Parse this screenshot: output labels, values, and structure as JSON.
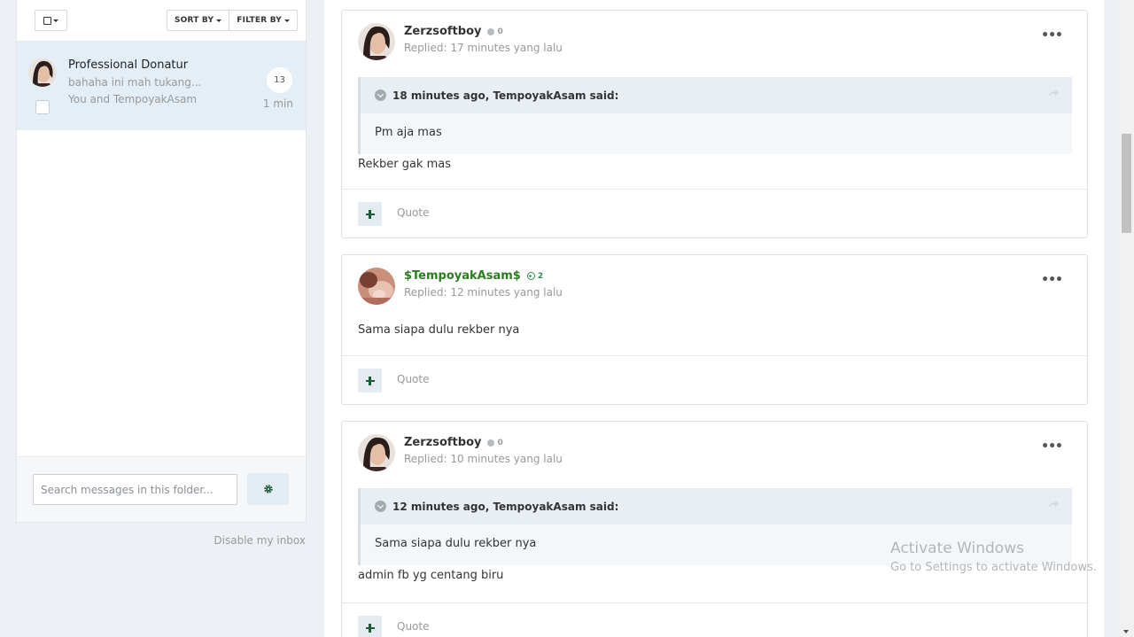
{
  "inbox": {
    "sort_label": "SORT BY",
    "filter_label": "FILTER BY",
    "conversation": {
      "title": "Professional Donatur",
      "snippet": "bahaha ini mah tukang...",
      "participants": "You and TempoyakAsam",
      "count": "13",
      "time": "1 min"
    },
    "search_placeholder": "Search messages in this folder...",
    "disable_link": "Disable my inbox"
  },
  "posts": [
    {
      "author": "Zerzsoftboy",
      "reputation": "0",
      "meta": "Replied: 17 minutes yang lalu",
      "quote_citation": "18 minutes ago, TempoyakAsam said:",
      "quote_text": "Pm aja mas",
      "text": "Rekber gak mas",
      "quote_button": "Quote"
    },
    {
      "author": "$TempoyakAsam$",
      "reputation": "2",
      "meta": "Replied: 12 minutes yang lalu",
      "text": "Sama siapa dulu rekber nya",
      "quote_button": "Quote"
    },
    {
      "author": "Zerzsoftboy",
      "reputation": "0",
      "meta": "Replied: 10 minutes yang lalu",
      "quote_citation": "12 minutes ago, TempoyakAsam said:",
      "quote_text": "Sama siapa dulu rekber nya",
      "text": "admin fb yg centang biru",
      "quote_button": "Quote"
    }
  ],
  "watermark": {
    "title": "Activate Windows",
    "subtitle": "Go to Settings to activate Windows."
  },
  "colors": {
    "accent_green": "#2a7d1f",
    "selected_row": "#e4eef6",
    "page_background": "#edf0f4"
  },
  "icons": [
    "checkbox-icon",
    "caret-down-icon",
    "gear-icon",
    "ellipsis-icon",
    "chevron-down-icon",
    "share-icon",
    "plus-icon"
  ]
}
